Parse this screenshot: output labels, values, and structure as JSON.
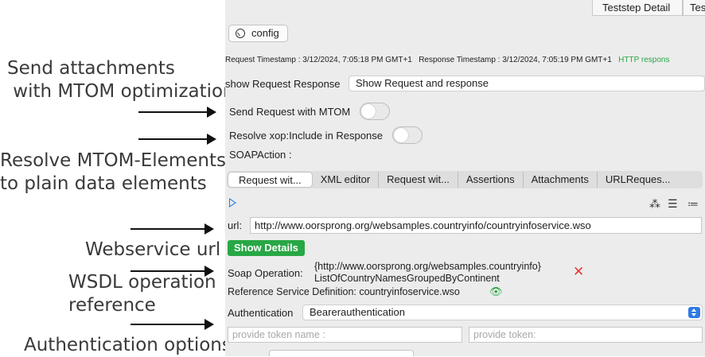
{
  "annotations": {
    "mtom": "Send attachments\n with MTOM optimization",
    "resolve": "Resolve MTOM-Elements\nto plain data elements",
    "url": "Webservice url",
    "wsdl": "WSDL operation\nreference",
    "auth": "Authentication options"
  },
  "top_tabs": [
    "Teststep Detail",
    "Tes"
  ],
  "config_label": "config",
  "timestamps": {
    "request": "Request Timestamp : 3/12/2024, 7:05:18 PM GMT+1",
    "response": "Response Timestamp : 3/12/2024, 7:05:19 PM GMT+1",
    "http": "HTTP respons"
  },
  "show_request": {
    "label": "show Request Response",
    "value": "Show Request and response"
  },
  "send_mtom_label": "Send Request with MTOM",
  "resolve_xop_label": "Resolve xop:Include in Response",
  "soap_action_label": "SOAPAction :",
  "tabs": [
    "Request wit...",
    "XML editor",
    "Request wit...",
    "Assertions",
    "Attachments",
    "URLReques..."
  ],
  "toolbar_icons": [
    "loading-icon",
    "format-icon",
    "list-icon"
  ],
  "url": {
    "label": "url:",
    "value": "http://www.oorsprong.org/websamples.countryinfo/countryinfoservice.wso"
  },
  "show_details_label": "Show Details",
  "soap_operation": {
    "label": "Soap Operation:",
    "line1": "{http://www.oorsprong.org/websamples.countryinfo}",
    "line2": "ListOfCountryNamesGroupedByContinent"
  },
  "ref_service": "Reference Service Definition: countryinfoservice.wso",
  "authentication": {
    "label": "Authentication",
    "value": "Bearerauthentication"
  },
  "token_name_placeholder": "provide token name :",
  "token_placeholder": "provide token:",
  "colors": {
    "accent": "#2f7ae5",
    "green": "#28a745",
    "red": "#e53935"
  }
}
